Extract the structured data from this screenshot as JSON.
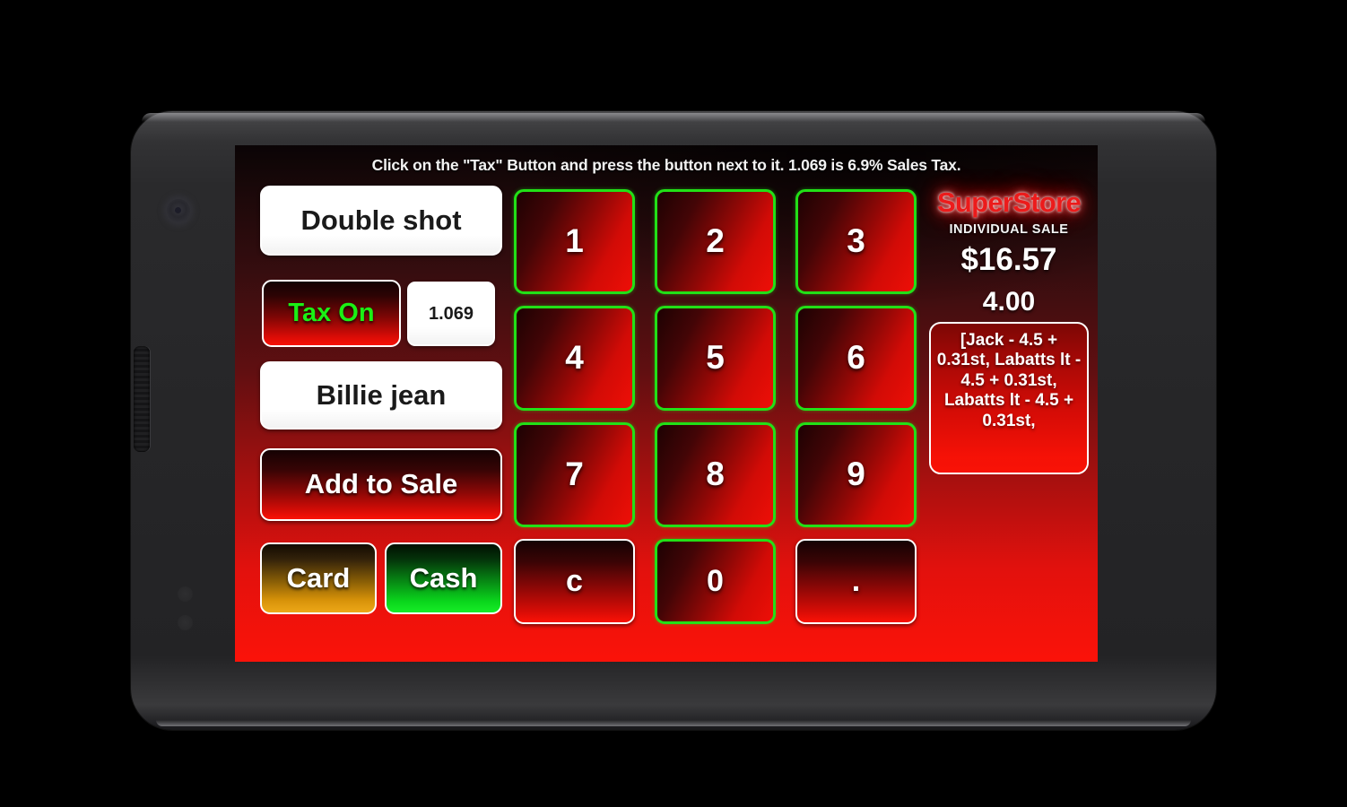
{
  "device": {
    "type": "android-phone-landscape"
  },
  "app": {
    "hint": "Click on the \"Tax\" Button and press the button next to it. 1.069 is 6.9% Sales Tax.",
    "left_column": {
      "double_shot_label": "Double shot",
      "tax_toggle_label": "Tax On",
      "tax_rate_value": "1.069",
      "item_label": "Billie jean",
      "add_to_sale_label": "Add to Sale",
      "card_label": "Card",
      "cash_label": "Cash"
    },
    "keypad": {
      "keys": [
        {
          "label": "1",
          "style": "green"
        },
        {
          "label": "2",
          "style": "green"
        },
        {
          "label": "3",
          "style": "green"
        },
        {
          "label": "4",
          "style": "green"
        },
        {
          "label": "5",
          "style": "green"
        },
        {
          "label": "6",
          "style": "green"
        },
        {
          "label": "7",
          "style": "green"
        },
        {
          "label": "8",
          "style": "green"
        },
        {
          "label": "9",
          "style": "green"
        },
        {
          "label": "c",
          "style": "white"
        },
        {
          "label": "0",
          "style": "green"
        },
        {
          "label": ".",
          "style": "white"
        }
      ]
    },
    "info_panel": {
      "brand": "SuperStore",
      "sale_mode": "INDIVIDUAL SALE",
      "total": "$16.57",
      "tendered": "4.00",
      "receipt": "[Jack - 4.5 + 0.31st, Labatts lt - 4.5 + 0.31st, Labatts lt - 4.5 + 0.31st,"
    }
  },
  "colors": {
    "brand_red": "#ec1b1b",
    "key_border_green": "#22e017",
    "tax_on_green": "#1bf015",
    "cash_green": "#0ad61c",
    "card_gold": "#d79209",
    "background_black": "#000000"
  }
}
